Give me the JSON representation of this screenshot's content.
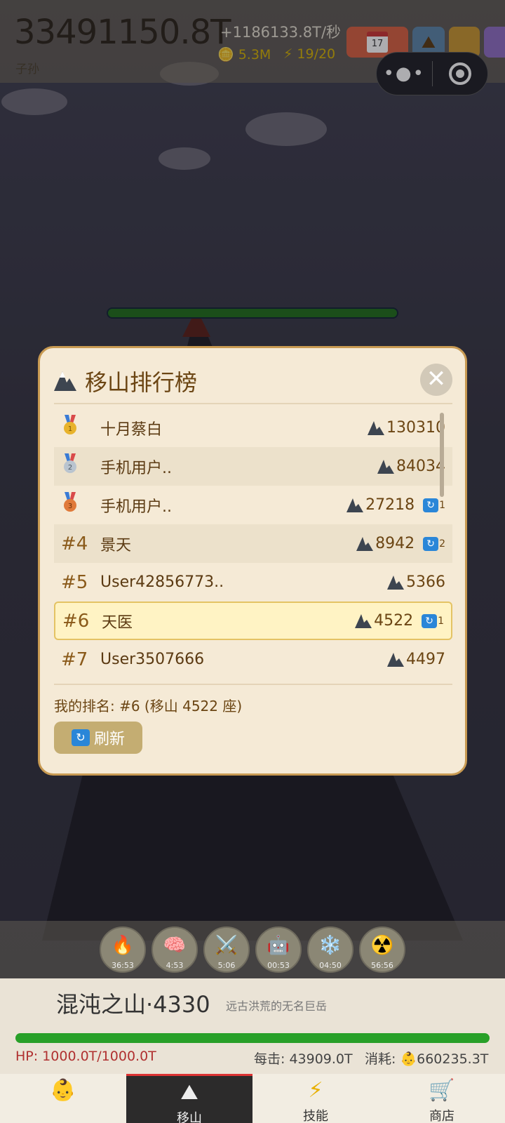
{
  "hud": {
    "total": "33491150.8T",
    "rate": "+1186133.8T/秒",
    "subtitle": "子孙",
    "coins": "5.3M",
    "energy": "19/20",
    "calendar_day": "17"
  },
  "leaderboard": {
    "title": "移山排行榜",
    "rows": [
      {
        "rank": "1",
        "name": "十月蔡白",
        "score": "130310",
        "rc": ""
      },
      {
        "rank": "2",
        "name": "手机用户..",
        "score": "84034",
        "rc": ""
      },
      {
        "rank": "3",
        "name": "手机用户..",
        "score": "27218",
        "rc": "1"
      },
      {
        "rank": "#4",
        "name": "景天",
        "score": "8942",
        "rc": "2"
      },
      {
        "rank": "#5",
        "name": "User42856773..",
        "score": "5366",
        "rc": ""
      },
      {
        "rank": "#6",
        "name": "天医",
        "score": "4522",
        "rc": "1"
      },
      {
        "rank": "#7",
        "name": "User3507666",
        "score": "4497",
        "rc": ""
      }
    ],
    "my_rank": "我的排名: #6 (移山 4522 座)",
    "refresh_label": "刷新"
  },
  "skills": [
    {
      "icon": "🔥",
      "label": "36:53"
    },
    {
      "icon": "🧠",
      "label": "4:53"
    },
    {
      "icon": "⚔️",
      "label": "5:06"
    },
    {
      "icon": "🤖",
      "label": "00:53"
    },
    {
      "icon": "❄️",
      "label": "04:50"
    },
    {
      "icon": "☢️",
      "label": "56:56"
    }
  ],
  "boss": {
    "name": "混沌之山·4330",
    "desc": "远古洪荒的无名巨岳",
    "hp": "HP: 1000.0T/1000.0T",
    "hit": "每击: 43909.0T",
    "cost_label": "消耗:",
    "cost": "660235.3T"
  },
  "nav": [
    {
      "icon": "baby-face-icon",
      "label": ""
    },
    {
      "icon": "mountain-icon",
      "label": "移山"
    },
    {
      "icon": "lightning-icon",
      "label": "技能"
    },
    {
      "icon": "cart-icon",
      "label": "商店"
    }
  ]
}
